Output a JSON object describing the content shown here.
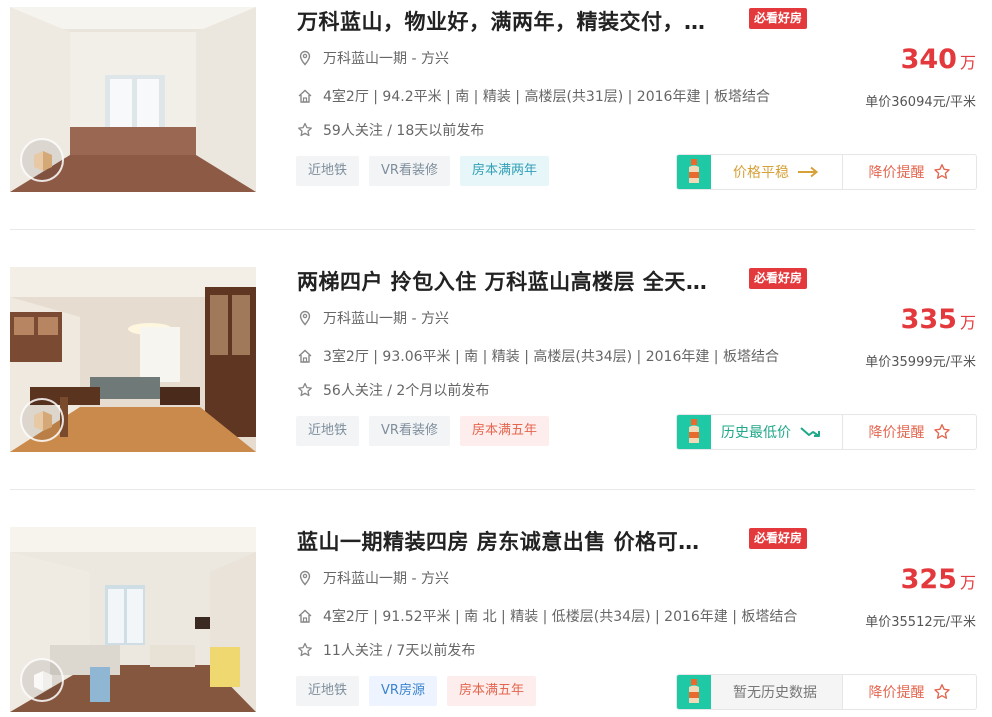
{
  "listings": [
    {
      "title": "万科蓝山，物业好，满两年，精装交付，…",
      "badge": "必看好房",
      "location": "万科蓝山一期 - 方兴",
      "info": "4室2厅 | 94.2平米 | 南 | 精装 | 高楼层(共31层) | 2016年建 | 板塔结合",
      "follow": "59人关注 / 18天以前发布",
      "tags": [
        "近地铁",
        "VR看装修",
        "房本满两年"
      ],
      "price": "340",
      "price_unit": "万",
      "unit_price": "单价36094元/平米",
      "trend_text": "价格平稳",
      "alert_text": "降价提醒"
    },
    {
      "title": "两梯四户 拎包入住 万科蓝山高楼层 全天…",
      "badge": "必看好房",
      "location": "万科蓝山一期 - 方兴",
      "info": "3室2厅 | 93.06平米 | 南 | 精装 | 高楼层(共34层) | 2016年建 | 板塔结合",
      "follow": "56人关注 / 2个月以前发布",
      "tags": [
        "近地铁",
        "VR看装修",
        "房本满五年"
      ],
      "price": "335",
      "price_unit": "万",
      "unit_price": "单价35999元/平米",
      "trend_text": "历史最低价",
      "alert_text": "降价提醒"
    },
    {
      "title": "蓝山一期精装四房 房东诚意出售 价格可…",
      "badge": "必看好房",
      "location": "万科蓝山一期 - 方兴",
      "info": "4室2厅 | 91.52平米 | 南 北 | 精装 | 低楼层(共34层) | 2016年建 | 板塔结合",
      "follow": "11人关注 / 7天以前发布",
      "tags": [
        "近地铁",
        "VR房源",
        "房本满五年"
      ],
      "price": "325",
      "price_unit": "万",
      "unit_price": "单价35512元/平米",
      "trend_text": "暂无历史数据",
      "alert_text": "降价提醒"
    }
  ],
  "colors": {
    "price_red": "#e4393c",
    "badge_red": "#e4393c",
    "trend_green": "#20c9a6",
    "alert_orange": "#e3664f"
  },
  "icons": {
    "location": "location-pin-icon",
    "house": "house-icon",
    "star": "star-outline-icon",
    "vr": "vr-icon",
    "arrow_right": "arrow-right-icon",
    "trend_down": "trend-down-icon"
  }
}
